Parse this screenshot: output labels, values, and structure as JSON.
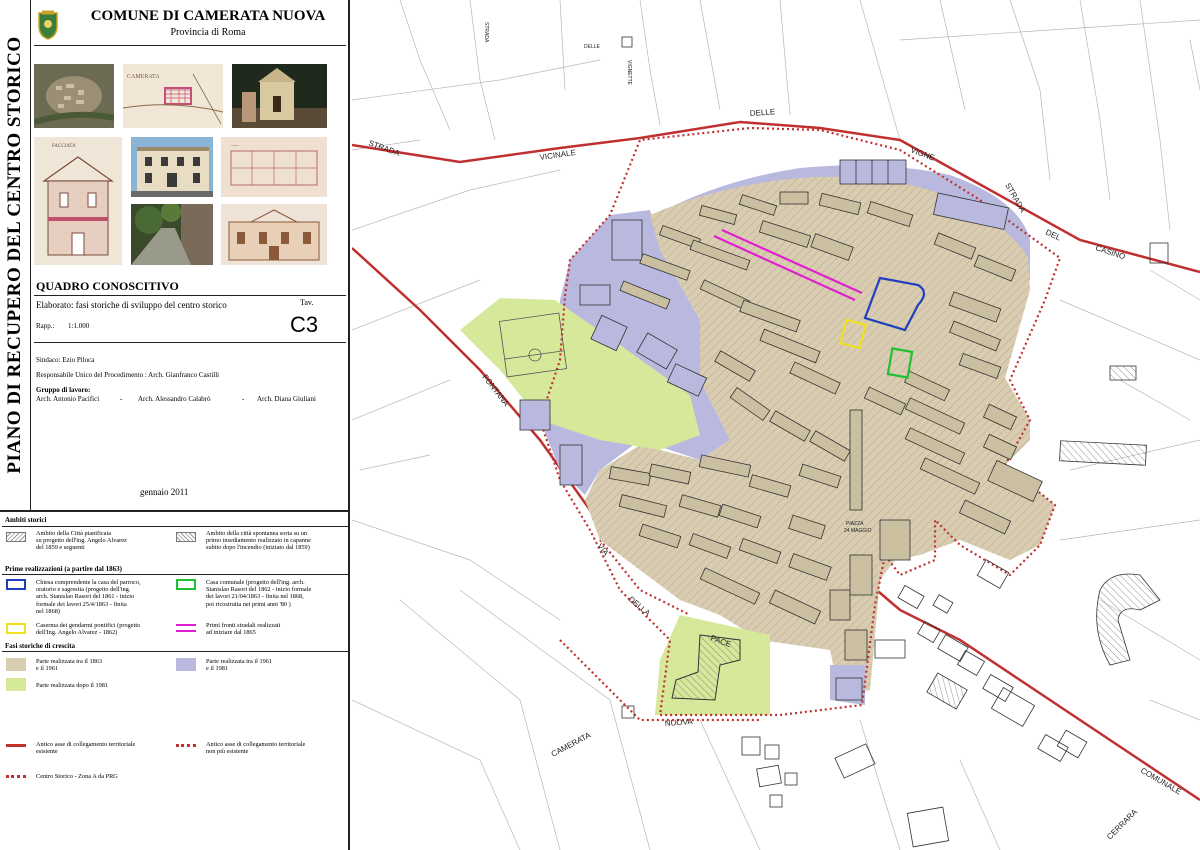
{
  "header": {
    "vertical_title": "PIANO DI RECUPERO DEL CENTRO STORICO",
    "comune": "COMUNE DI CAMERATA NUOVA",
    "provincia": "Provincia di Roma"
  },
  "sheet": {
    "section": "QUADRO CONOSCITIVO",
    "elaborato": "Elaborato:  fasi storiche di sviluppo del centro storico",
    "tav_label": "Tav.",
    "tav_code": "C3",
    "rapp_label": "Rapp.:",
    "rapp_value": "1:1.000",
    "date": "gennaio 2011"
  },
  "credits": {
    "sindaco": "Sindaco: Ezio Piloca",
    "rup": "Responsabile Unico del Procedimento : Arch. Gianfranco Castilli",
    "gruppo_label": "Gruppo di lavoro:",
    "member1": "Arch. Antonio Pacifici",
    "member2": "Arch. Alessandro Calabrò",
    "member3": "Arch. Diana Giuliani",
    "sep": "-"
  },
  "legend": {
    "ambiti_title": "Ambiti storici",
    "ambito1": [
      "Ambito della Città pianificata",
      "su progetto dell'ing. Angelo Alvarez",
      "del 1859  e seguenti"
    ],
    "ambito2": [
      "Ambito della città spontanea sorta su un",
      "primo insediamento realizzato in capanne",
      "subito dopo l'incendio (iniziato dal 1859)"
    ],
    "prime_title": "Prime realizzazioni (a partire dal 1863)",
    "chiesa": [
      "Chiesa comprendente la casa del parroco,",
      "oratorio e sagrestia (progetto dell'ing.",
      "arch. Stanislao Rasori del 1861 - inizio",
      "formale dei lavori 25/4/1863 - finita",
      "nel 1868)"
    ],
    "casa": [
      "Casa comunale (progetto dell'ing. arch.",
      "Stanislao Rasori del 1862 - inizio formale",
      "dei lavori 21/04/1863 - finita nel 1868,",
      "poi ricostruita nei primi anni '80 )"
    ],
    "caserma": [
      "Caserma dei gendarmi pontifici (progetto",
      "dell'Ing. Angelo Alvarez - 1862)"
    ],
    "fronti": [
      "Primi fronti stradali realizzati",
      "ad iniziare dal 1865"
    ],
    "fasi_title": "Fasi storiche di crescita",
    "fase1": [
      "Parte realizzata tra il 1863",
      "e il 1961"
    ],
    "fase2": [
      "Parte  realizzata tra il 1961",
      "e il 1981"
    ],
    "fase3": [
      "Parte realizzata dopo il 1981"
    ],
    "asse1": [
      "Antico asse di collegamento territoriale",
      "esistente"
    ],
    "asse2": [
      "Antico asse di collegamento territoriale",
      "non più esistente"
    ],
    "zona": [
      "Centro Storico - Zona A da PRG"
    ]
  },
  "map_labels": {
    "strada": "STRADA",
    "vicinale": "VICINALE",
    "delle": "DELLE",
    "vigne": "VIGNE",
    "strada_r": "STRADA",
    "del": "DEL",
    "casino": "CASINO",
    "fontana": "FONTANA",
    "via": "VIA",
    "della": "DELLA",
    "pace": "PACE",
    "camerata": "CAMERATA",
    "nuova": "NUOVA",
    "comunale": "COMUNALE",
    "cerrara": "CERRARA",
    "piazza_maggio": [
      "PIAZZA",
      "24 MAGGIO"
    ],
    "strada_small": "STRADA",
    "delle_small": "DELLE",
    "vignette": "VIGNETTE"
  },
  "colors": {
    "phase_1863_1961": "#d9ccb0",
    "phase_1961_1981": "#b9b9df",
    "phase_after_1981": "#d6e89a",
    "road": "#c03030",
    "chiesa": "#1f3fc0",
    "caserma": "#f0e020",
    "casa_comunale": "#20c030",
    "fronti": "#e020d0"
  }
}
